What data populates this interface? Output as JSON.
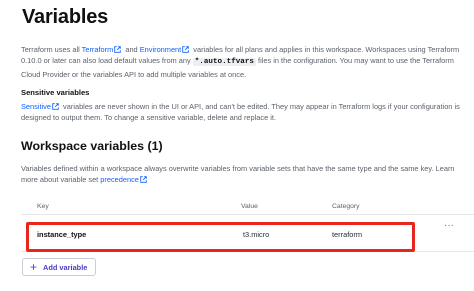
{
  "page": {
    "title": "Variables"
  },
  "intro": {
    "t1": "Terraform uses all ",
    "link_terraform": "Terraform",
    "t2": " and ",
    "link_environment": "Environment",
    "t3": " variables for all plans and applies in this workspace. Workspaces using Terraform 0.10.0 or later can also load default values from any ",
    "code": "*.auto.tfvars",
    "t4": " files in the configuration. You may want to use the Terraform Cloud Provider or the variables API to add multiple variables at once."
  },
  "sensitive": {
    "heading": "Sensitive variables",
    "link": "Sensitive",
    "text": " variables are never shown in the UI or API, and can't be edited. They may appear in Terraform logs if your configuration is designed to output them. To change a sensitive variable, delete and replace it."
  },
  "workspace": {
    "heading": "Workspace variables (1)",
    "desc": "Variables defined within a workspace always overwrite variables from variable sets that have the same type and the same key. Learn more about variable set ",
    "link": "precedence"
  },
  "table": {
    "headers": {
      "key": "Key",
      "value": "Value",
      "category": "Category"
    },
    "rows": [
      {
        "key": "instance_type",
        "value": "t3.micro",
        "category": "terraform",
        "menu": "···"
      }
    ]
  },
  "actions": {
    "add_variable": "Add variable",
    "add_icon": "+"
  },
  "colors": {
    "link": "#1060ff",
    "highlight": "#e8261e",
    "button_text": "#4b3cc9"
  }
}
